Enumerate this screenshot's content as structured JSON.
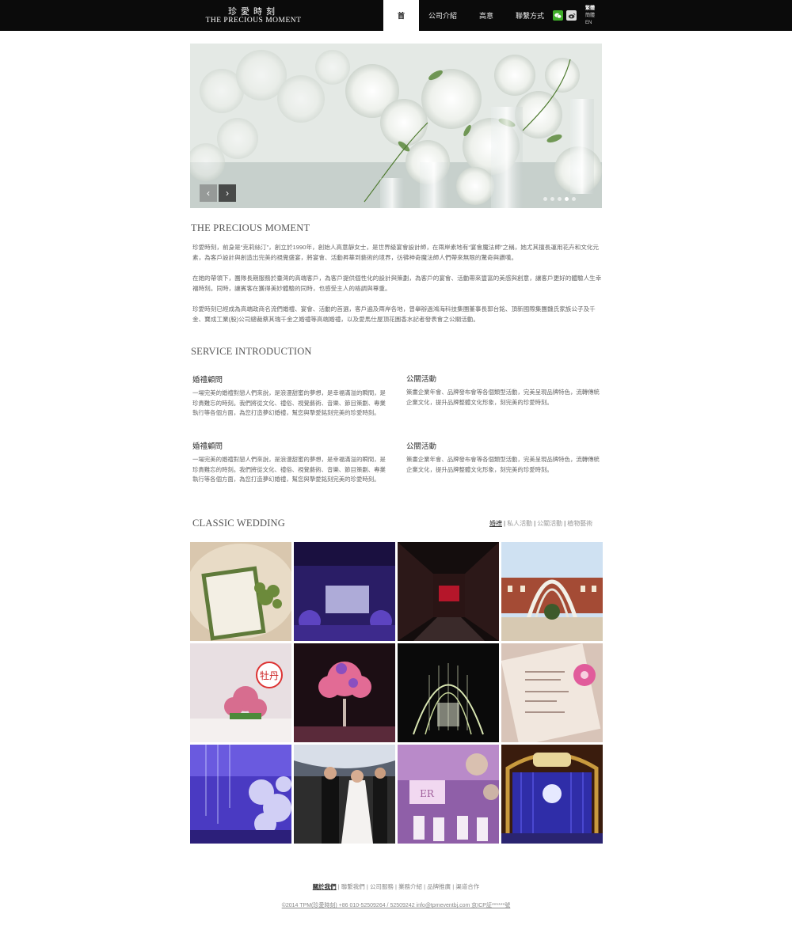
{
  "header": {
    "logo_cn": "珍愛時刻",
    "logo_en": "THE PRECIOUS MOMENT",
    "nav": [
      "首頁",
      "公司介紹",
      "高意靜",
      "聯繫方式"
    ],
    "lang": [
      "繁體",
      "簡體",
      "EN"
    ]
  },
  "banner": {
    "slide_count": 5,
    "active_slide": 3,
    "prev_label": "‹",
    "next_label": "›"
  },
  "about": {
    "title": "THE PRECIOUS MOMENT",
    "p1": "珍愛時刻，前身是“克莉絲汀”，創立於1990年，創始人高意靜女士，是世界級宴會設計師，在兩岸素地有“宴會魔法師”之稱，她尤其擅長運用花卉和文化元素，為客戶設計與創造出完美的視覺盛宴，將宴會、活動昇華到藝術的境界，彷彿神奇魔法師人們帶來無限的驚奇與讚嘆。",
    "p2": "在她的帶領下，團隊長期服務於臺灣的高端客戶，為客戶提供個性化的設計與策劃，為客戶的宴會、活動帶來豐富的美感與創意，讓客戶更好的體驗人生幸福時刻。同時，讓賓客在獲得美妙體驗的同時，也感受主人的格調與尊重。",
    "p3": "珍愛時刻已經成為高端政商名流們婚禮、宴會、活動的首選，客戶遍及兩岸各地，曾舉辦過鴻海科技集團董事長郭台銘、頂新國際集團魏氏家族公子及千金、寶成工業(股)公司總裁蔡其瑞千金之婚禮等高端婚禮，以及愛馬仕屋頂花園香水記者發表會之公關活動。"
  },
  "services": {
    "title": "SERVICE INTRODUCTION",
    "items": [
      {
        "title": "婚禮顧問",
        "desc": "一場完美的婚禮對戀人們來說，是浪漫甜蜜的夢想，是幸福滿溢的瞬間，是珍貴難忘的時刻。我們將從文化、禮俗、視覺藝術、音樂、節目策劃、專業執行等各個方面，為您打造夢幻婚禮，幫您與摯愛銘刻完美的珍愛時刻。"
      },
      {
        "title": "公關活動",
        "desc": "策畫企業年會、品牌發布會等各個類型活動，完美呈現品牌特色，流轉傳統企業文化，提升品牌整體文化形象，刻完美的珍愛時刻。"
      },
      {
        "title": "婚禮顧問",
        "desc": "一場完美的婚禮對戀人們來說，是浪漫甜蜜的夢想，是幸福滿溢的瞬間，是珍貴難忘的時刻。我們將從文化、禮俗、視覺藝術、音樂、節目策劃、專業執行等各個方面，為您打造夢幻婚禮，幫您與摯愛銘刻完美的珍愛時刻。"
      },
      {
        "title": "公關活動",
        "desc": "策畫企業年會、品牌發布會等各個類型活動，完美呈現品牌特色，流轉傳統企業文化，提升品牌整體文化形象，刻完美的珍愛時刻。"
      }
    ]
  },
  "gallery": {
    "title": "CLASSIC WEDDING",
    "filters": [
      "婚禮",
      "私人活動",
      "公關活動",
      "植物藝術"
    ],
    "active_filter": "婚禮",
    "tile_count": 12
  },
  "footer": {
    "links": [
      "關於我們",
      "聯繫我們",
      "公司服務",
      "業務介紹",
      "品牌推廣",
      "渠道合作"
    ],
    "copyright": "©2014 TPM(珍愛時刻) +86 010-52509264 / 52509242 info@tpmeventbj.com 京ICP証******號"
  },
  "colors": {
    "header_bg": "#0b0b0b",
    "wechat": "#3fae2a",
    "text": "#555555"
  }
}
